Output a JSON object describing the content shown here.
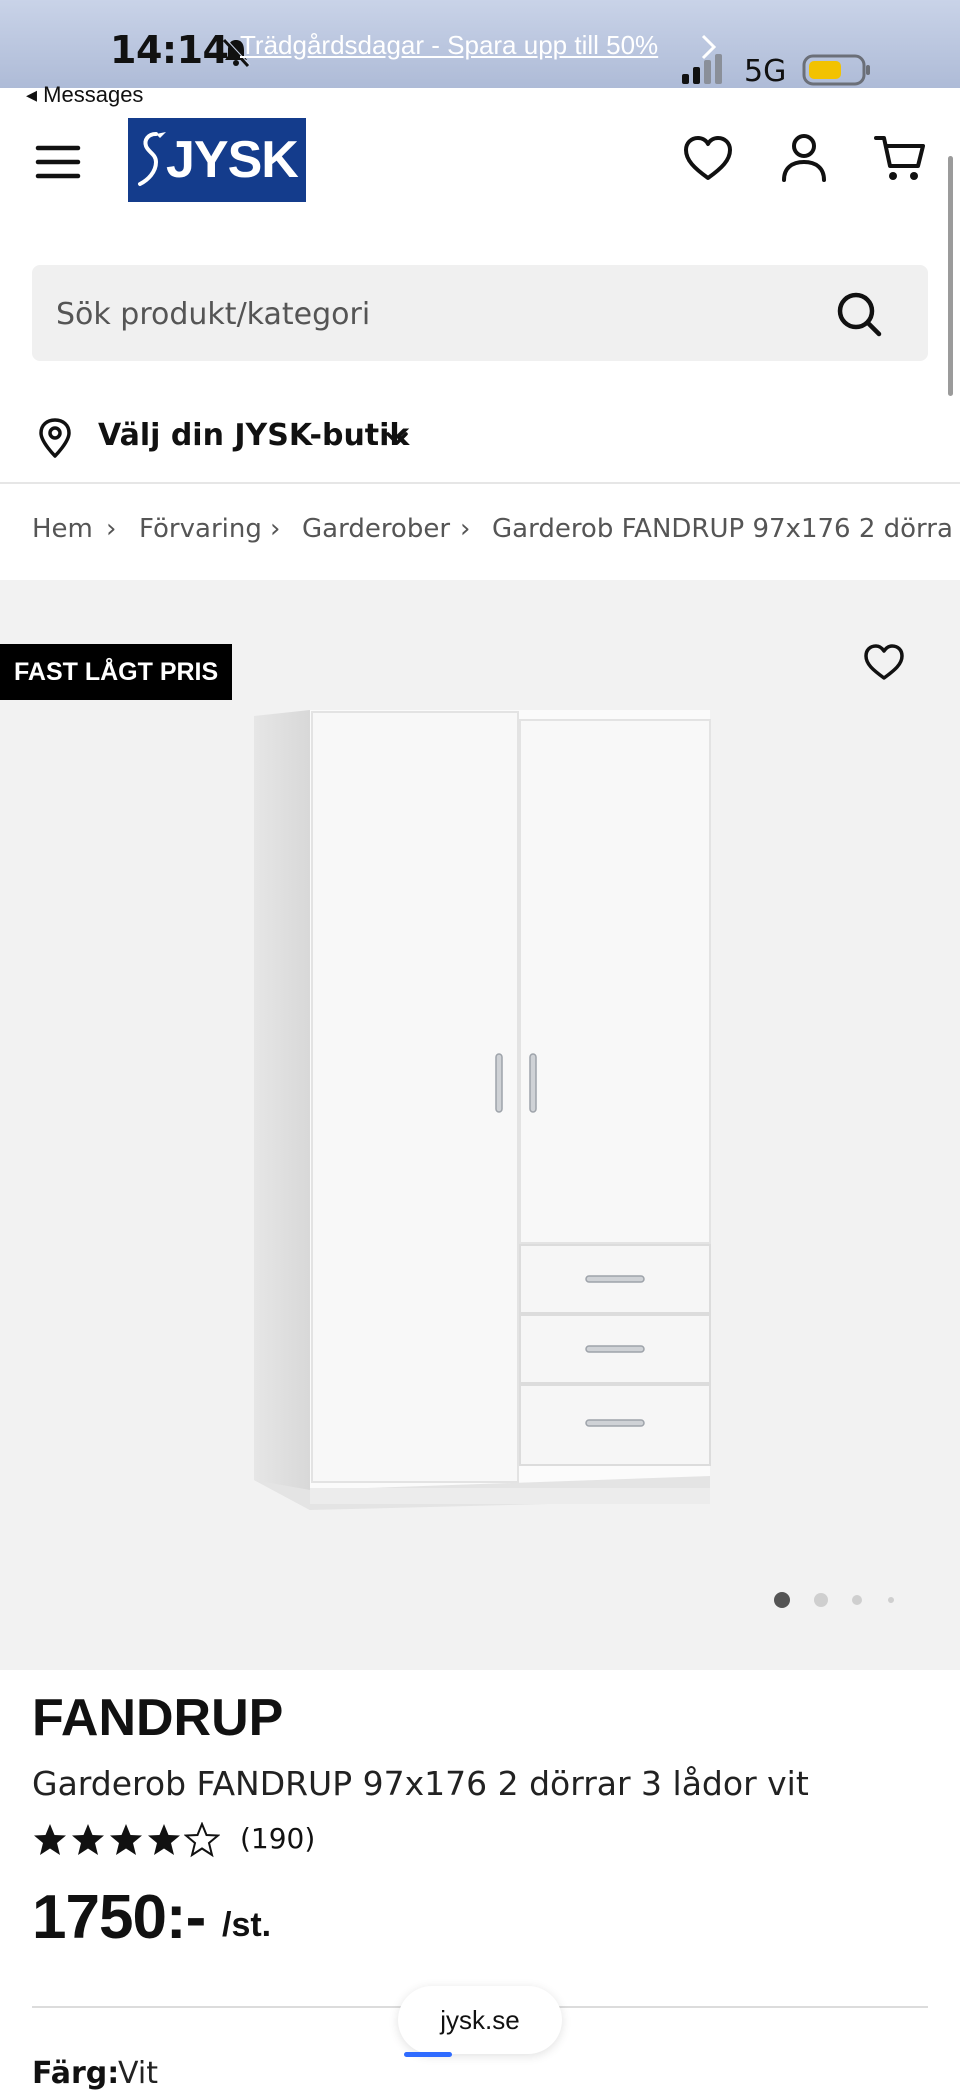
{
  "status_bar": {
    "time": "14:14",
    "promo_text": "Trädgårdsdagar - Spara upp till 50%",
    "network": "5G",
    "back_label": "◂ Messages",
    "icons": [
      "bell-slash-icon",
      "signal-icon",
      "battery-icon"
    ]
  },
  "header": {
    "logo_text": "JYSK",
    "icons": [
      "menu-icon",
      "heart-icon",
      "user-icon",
      "cart-icon"
    ]
  },
  "search": {
    "placeholder": "Sök produkt/kategori",
    "value": ""
  },
  "store": {
    "label": "Välj din JYSK-butik"
  },
  "breadcrumb": [
    "Hem",
    "Förvaring",
    "Garderober",
    "Garderob FANDRUP 97x176 2 dörra"
  ],
  "gallery": {
    "badge": "FAST LÅGT PRIS",
    "image_count": 4,
    "active_image": 1
  },
  "product": {
    "brand": "FANDRUP",
    "name": "Garderob FANDRUP 97x176 2 dörrar 3 lådor vit",
    "rating": 4,
    "rating_max": 5,
    "review_count": "(190)",
    "price": "1750:-",
    "price_unit": "/st.",
    "color_label": "Färg:",
    "color_value": "Vit"
  },
  "browser": {
    "url": "jysk.se"
  },
  "colors": {
    "brand_blue": "#143c8c",
    "badge_bg": "#000000",
    "gallery_bg": "#f2f2f2"
  }
}
